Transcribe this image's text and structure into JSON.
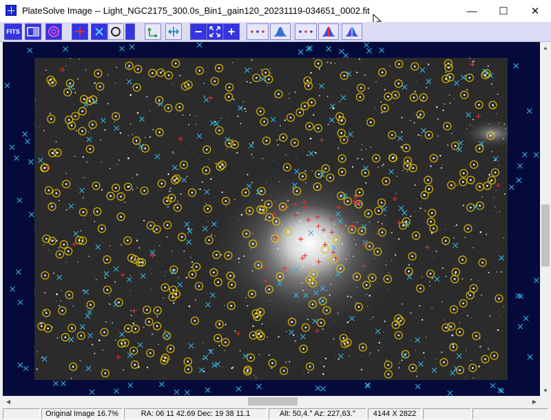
{
  "window": {
    "title": "PlateSolve Image -- Light_NGC2175_300.0s_Bin1_gain120_20231119-034651_0002.fit",
    "minimize_glyph": "—",
    "maximize_glyph": "☐",
    "close_glyph": "✕"
  },
  "toolbar": {
    "fits_label": "FITS",
    "zoom_out_label": "−",
    "zoom_in_label": "+"
  },
  "statusbar": {
    "zoom": "Original Image 16.7%",
    "coords": "RA: 06 11 42.69  Dec: 19 38 11.1",
    "altaz": "Alt: 50,4.°  Az: 227,63.°",
    "size": "4144 X 2822"
  },
  "colors": {
    "titlebar": "#ffffff",
    "toolbar_bg": "#dcdcf4",
    "toolbar_button": "#3434e0",
    "frame_bg": "#050a3a",
    "star_circle": "#e8c200",
    "catalog_cross": "#33b5e5",
    "detected_cross": "#e03030"
  }
}
